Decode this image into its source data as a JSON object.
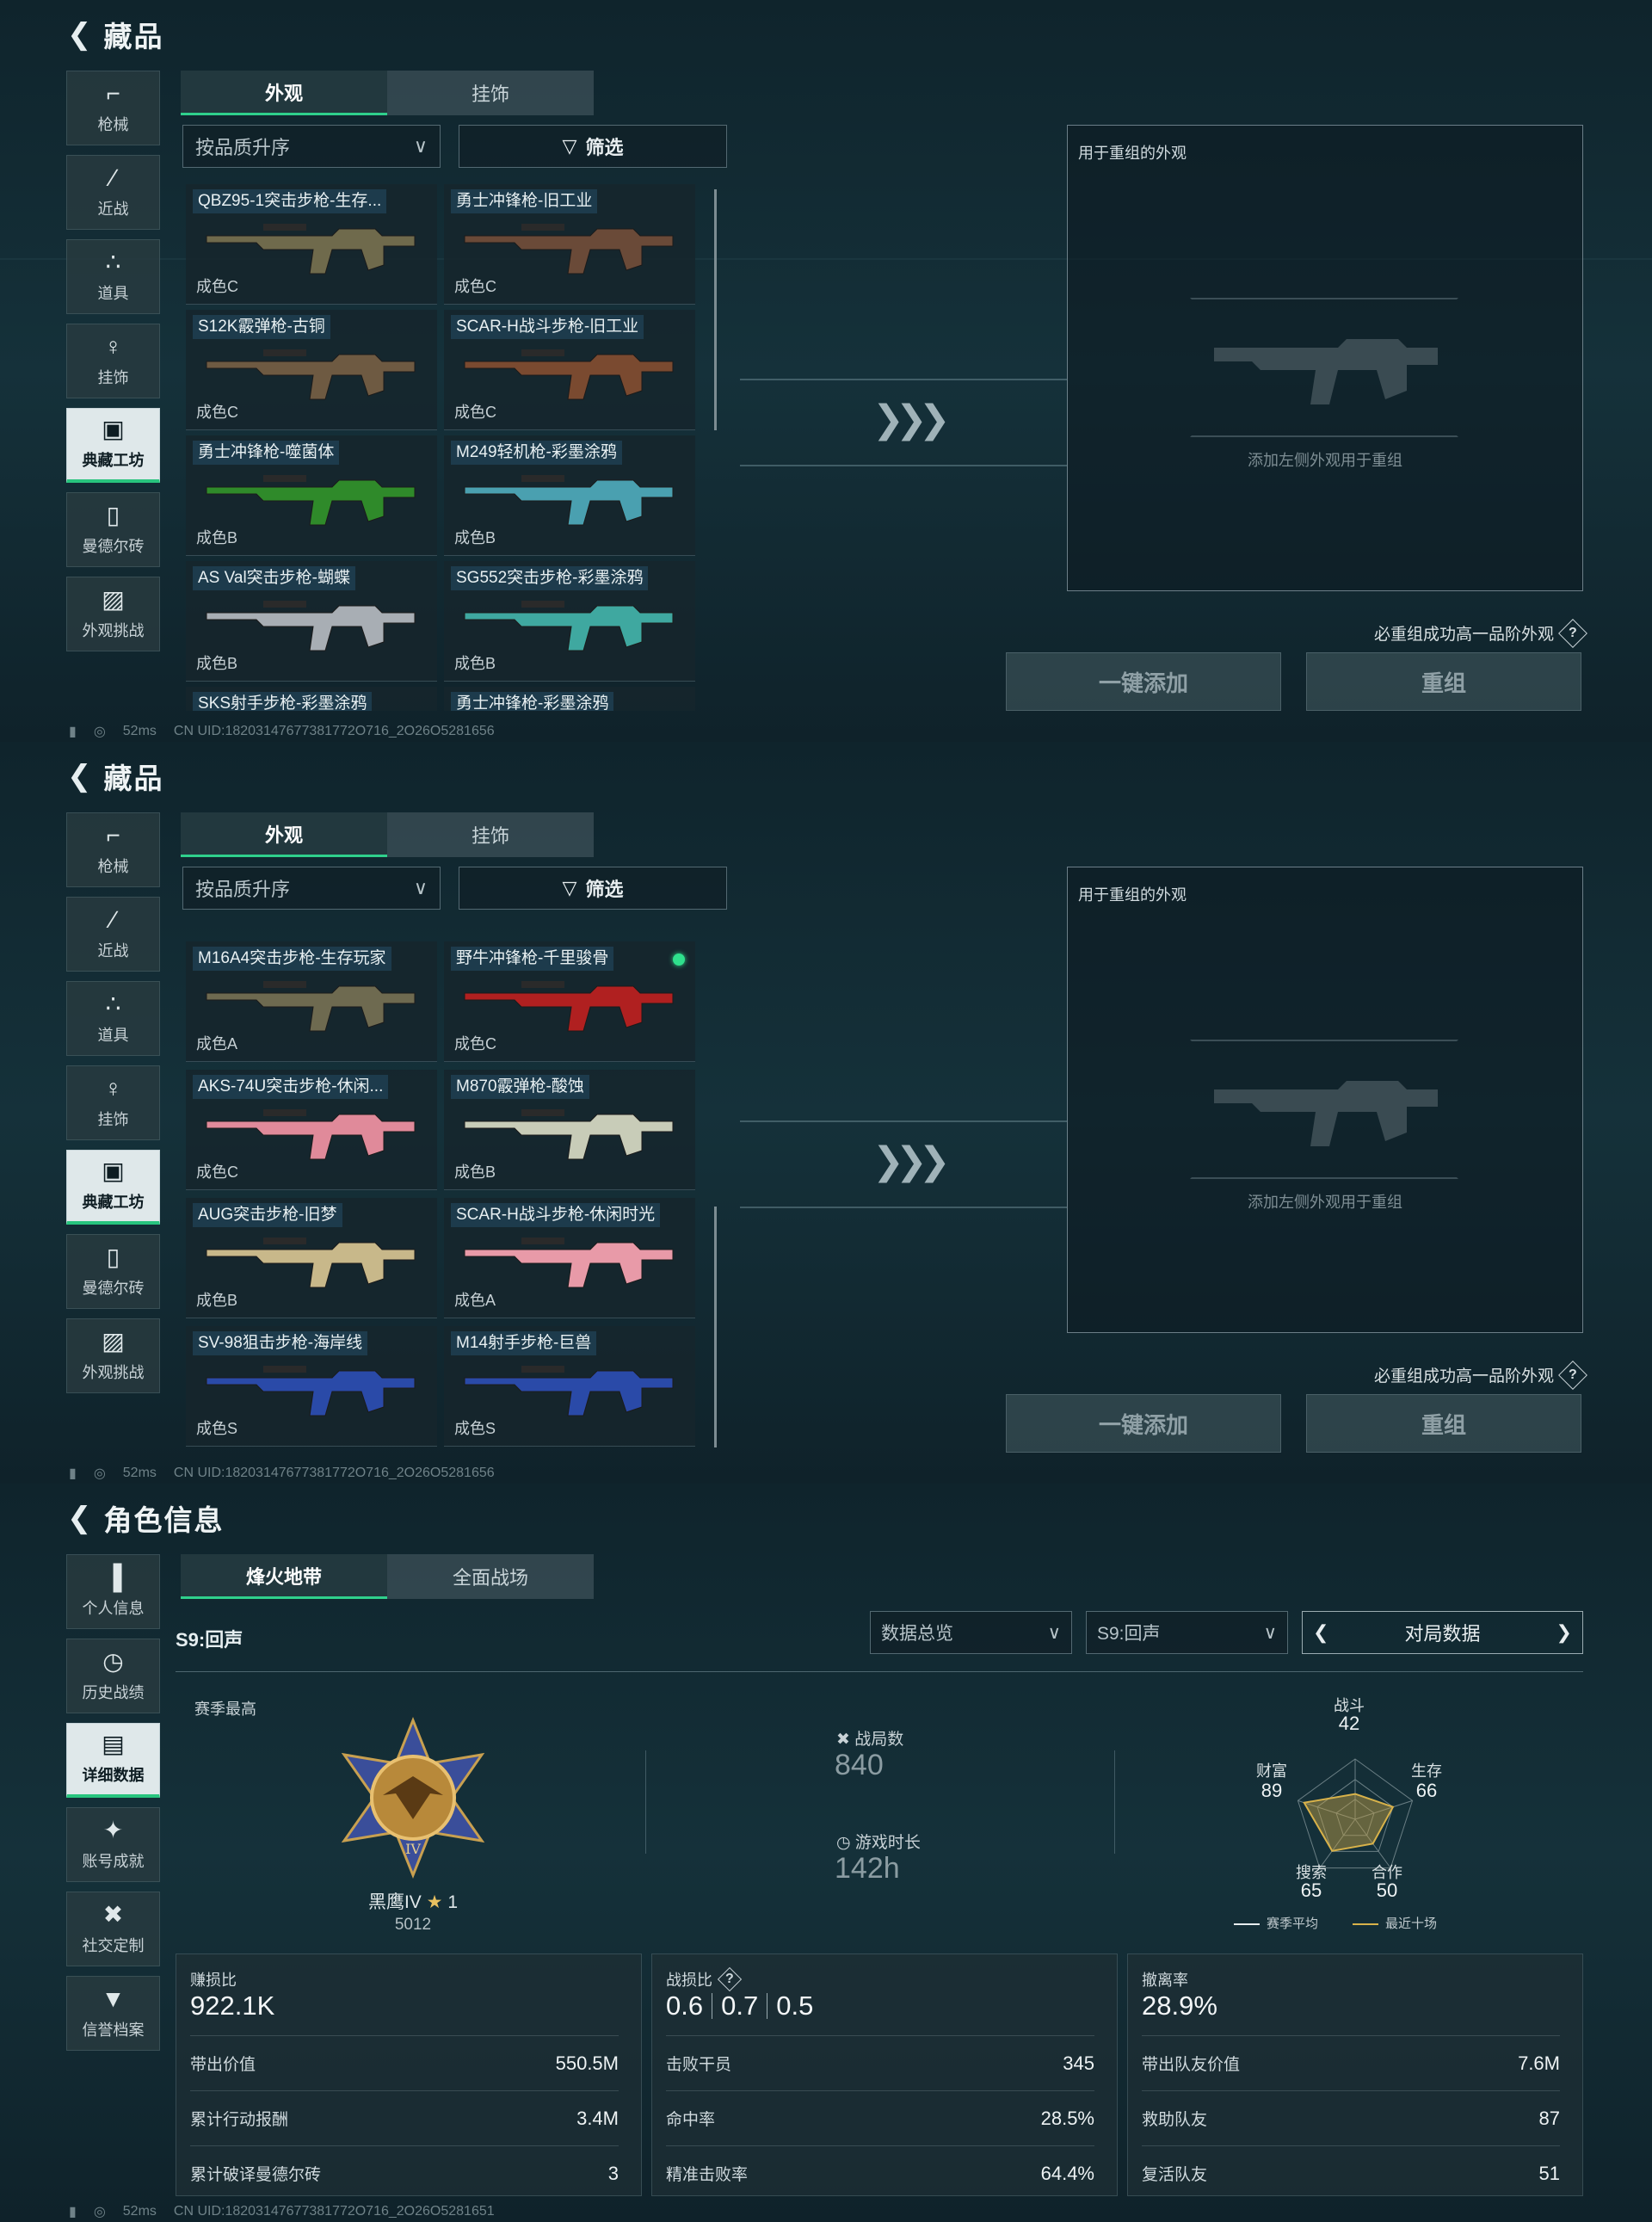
{
  "status": {
    "ping": "52ms",
    "uid1": "CN UID:18203147677381772O716_2O26O5281656",
    "uid3": "CN UID:18203147677381772O716_2O26O5281651"
  },
  "collection": {
    "title": "藏品",
    "nav": [
      {
        "label": "枪械",
        "icon": "pistol-icon"
      },
      {
        "label": "近战",
        "icon": "knife-icon"
      },
      {
        "label": "道具",
        "icon": "grenades-icon"
      },
      {
        "label": "挂饰",
        "icon": "charm-icon"
      },
      {
        "label": "典藏工坊",
        "icon": "workshop-icon"
      },
      {
        "label": "曼德尔砖",
        "icon": "brick-icon"
      },
      {
        "label": "外观挑战",
        "icon": "challenge-icon"
      }
    ],
    "active_nav": 4,
    "tabs": [
      "外观",
      "挂饰"
    ],
    "sort_label": "按品质升序",
    "filter_label": "筛选",
    "recombine_title": "用于重组的外观",
    "recombine_hint": "添加左侧外观用于重组",
    "must_text": "必重组成功高一品阶外观",
    "btn_add": "一键添加",
    "btn_recombine": "重组",
    "items_page1": [
      {
        "name": "QBZ95-1突击步枪-生存...",
        "grade": "成色C",
        "color": "#6f6a4c"
      },
      {
        "name": "勇士冲锋枪-旧工业",
        "grade": "成色C",
        "color": "#6a4a38"
      },
      {
        "name": "S12K霰弹枪-古铜",
        "grade": "成色C",
        "color": "#6e5a42"
      },
      {
        "name": "SCAR-H战斗步枪-旧工业",
        "grade": "成色C",
        "color": "#7a4a30"
      },
      {
        "name": "勇士冲锋枪-噬菌体",
        "grade": "成色B",
        "color": "#2f8a2a"
      },
      {
        "name": "M249轻机枪-彩墨涂鸦",
        "grade": "成色B",
        "color": "#4aa0b0"
      },
      {
        "name": "AS Val突击步枪-蝴蝶",
        "grade": "成色B",
        "color": "#a8aeb4"
      },
      {
        "name": "SG552突击步枪-彩墨涂鸦",
        "grade": "成色B",
        "color": "#3fa8a0"
      },
      {
        "name": "SKS射手步枪-彩墨涂鸦",
        "grade": "",
        "color": "#4a8a90"
      },
      {
        "name": "勇士冲锋枪-彩墨涂鸦",
        "grade": "",
        "color": "#4a8a90"
      }
    ],
    "items_page2": [
      {
        "name": "M16A4突击步枪-生存玩家",
        "grade": "成色A",
        "color": "#6e6a50",
        "new": false
      },
      {
        "name": "野牛冲锋枪-千里骏骨",
        "grade": "成色C",
        "color": "#b02020",
        "new": true
      },
      {
        "name": "AKS-74U突击步枪-休闲...",
        "grade": "成色C",
        "color": "#e08a9a",
        "new": false
      },
      {
        "name": "M870霰弹枪-酸蚀",
        "grade": "成色B",
        "color": "#c8ccb8",
        "new": false
      },
      {
        "name": "AUG突击步枪-旧梦",
        "grade": "成色B",
        "color": "#c8b88a",
        "new": false
      },
      {
        "name": "SCAR-H战斗步枪-休闲时光",
        "grade": "成色A",
        "color": "#e89aa8",
        "new": false
      },
      {
        "name": "SV-98狙击步枪-海岸线",
        "grade": "成色S",
        "color": "#2a4aa8",
        "new": false
      },
      {
        "name": "M14射手步枪-巨兽",
        "grade": "成色S",
        "color": "#2a4aa8",
        "new": false
      }
    ]
  },
  "profile": {
    "title": "角色信息",
    "nav": [
      {
        "label": "个人信息",
        "icon": "bar-chart-icon"
      },
      {
        "label": "历史战绩",
        "icon": "history-icon"
      },
      {
        "label": "详细数据",
        "icon": "folder-icon"
      },
      {
        "label": "账号成就",
        "icon": "achievement-icon"
      },
      {
        "label": "社交定制",
        "icon": "tools-icon"
      },
      {
        "label": "信誉档案",
        "icon": "reputation-icon"
      }
    ],
    "active_nav": 2,
    "tabs": [
      "烽火地带",
      "全面战场"
    ],
    "season_label": "S9:回声",
    "dd_overview": "数据总览",
    "dd_season": "S9:回声",
    "pager_label": "对局数据",
    "best_label": "赛季最高",
    "rank_name": "黑鹰IV",
    "rank_stars": "1",
    "rank_score": "5012",
    "matches_label": "战局数",
    "matches_value": "840",
    "playtime_label": "游戏时长",
    "playtime_value": "142h",
    "radar": {
      "labels": {
        "combat": "战斗",
        "survival": "生存",
        "coop": "合作",
        "search": "搜索",
        "wealth": "财富"
      },
      "values": {
        "combat": 42,
        "survival": 66,
        "coop": 50,
        "search": 65,
        "wealth": 89
      },
      "legend_avg": "赛季平均",
      "legend_recent": "最近十场",
      "color_recent": "#d8b24a"
    },
    "card1": {
      "title": "赚损比",
      "value": "922.1K",
      "rows": [
        {
          "k": "带出价值",
          "v": "550.5M"
        },
        {
          "k": "累计行动报酬",
          "v": "3.4M"
        },
        {
          "k": "累计破译曼德尔砖",
          "v": "3"
        }
      ]
    },
    "card2": {
      "title": "战损比",
      "kd": [
        "0.6",
        "0.7",
        "0.5"
      ],
      "rows": [
        {
          "k": "击败干员",
          "v": "345"
        },
        {
          "k": "命中率",
          "v": "28.5%"
        },
        {
          "k": "精准击败率",
          "v": "64.4%"
        }
      ]
    },
    "card3": {
      "title": "撤离率",
      "value": "28.9%",
      "rows": [
        {
          "k": "带出队友价值",
          "v": "7.6M"
        },
        {
          "k": "救助队友",
          "v": "87"
        },
        {
          "k": "复活队友",
          "v": "51"
        }
      ]
    }
  }
}
